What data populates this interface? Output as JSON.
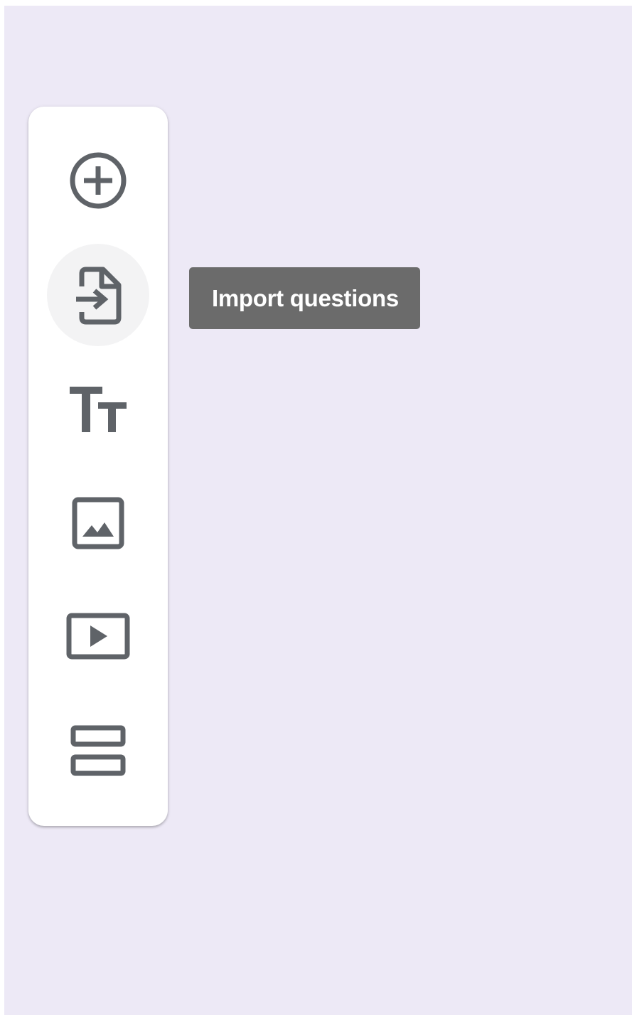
{
  "colors": {
    "background": "#ede9f6",
    "toolbar": "#ffffff",
    "icon": "#5f6368",
    "hover_circle": "#f3f3f4",
    "tooltip_bg": "#6b6b6b",
    "tooltip_text": "#ffffff"
  },
  "toolbar": {
    "items": [
      {
        "name": "add-question",
        "icon": "add-circle-icon"
      },
      {
        "name": "import-questions",
        "icon": "import-file-icon",
        "hovered": true
      },
      {
        "name": "add-title-and-description",
        "icon": "title-text-icon"
      },
      {
        "name": "add-image",
        "icon": "image-icon"
      },
      {
        "name": "add-video",
        "icon": "video-icon"
      },
      {
        "name": "add-section",
        "icon": "section-icon"
      }
    ]
  },
  "tooltip": {
    "text": "Import questions"
  }
}
